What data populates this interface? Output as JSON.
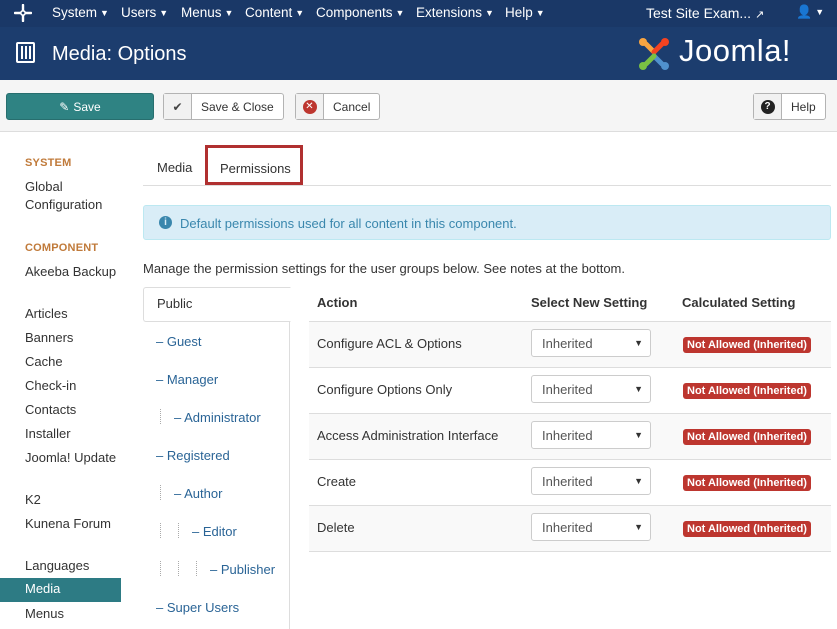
{
  "topnav": {
    "menus": [
      {
        "label": "System",
        "icon": "caret-down-icon"
      },
      {
        "label": "Users",
        "icon": "caret-down-icon"
      },
      {
        "label": "Menus",
        "icon": "caret-down-icon"
      },
      {
        "label": "Content",
        "icon": "caret-down-icon"
      },
      {
        "label": "Components",
        "icon": "caret-down-icon"
      },
      {
        "label": "Extensions",
        "icon": "caret-down-icon"
      },
      {
        "label": "Help",
        "icon": "caret-down-icon"
      }
    ],
    "site_label": "Test Site Exam...",
    "site_icon": "external-link-icon",
    "user_icon": "user-icon"
  },
  "header": {
    "title": "Media: Options",
    "brand": "Joomla!",
    "title_icon": "options-icon"
  },
  "toolbar": {
    "save_label": "Save",
    "save_close_label": "Save & Close",
    "cancel_label": "Cancel",
    "help_label": "Help"
  },
  "sidebar": {
    "system_heading": "SYSTEM",
    "system_items": [
      "Global Configuration"
    ],
    "component_heading": "COMPONENT",
    "component_items": [
      "Akeeba Backup",
      "Articles",
      "Banners",
      "Cache",
      "Check-in",
      "Contacts",
      "Installer",
      "Joomla! Update",
      "K2",
      "Kunena Forum",
      "Languages",
      "Media",
      "Menus"
    ],
    "active_item": "Media"
  },
  "tabs": {
    "media": "Media",
    "permissions": "Permissions",
    "active": "Permissions"
  },
  "info": {
    "message": "Default permissions used for all content in this component."
  },
  "manage_text": "Manage the permission settings for the user groups below. See notes at the bottom.",
  "groups": [
    "Public",
    "– Guest",
    "– Manager",
    "– Administrator",
    "– Registered",
    "– Author",
    "– Editor",
    "– Publisher",
    "– Super Users"
  ],
  "table": {
    "headers": [
      "Action",
      "Select New Setting",
      "Calculated Setting"
    ],
    "rows": [
      {
        "action": "Configure ACL & Options",
        "setting": "Inherited",
        "calculated": "Not Allowed (Inherited)"
      },
      {
        "action": "Configure Options Only",
        "setting": "Inherited",
        "calculated": "Not Allowed (Inherited)"
      },
      {
        "action": "Access Administration Interface",
        "setting": "Inherited",
        "calculated": "Not Allowed (Inherited)"
      },
      {
        "action": "Create",
        "setting": "Inherited",
        "calculated": "Not Allowed (Inherited)"
      },
      {
        "action": "Delete",
        "setting": "Inherited",
        "calculated": "Not Allowed (Inherited)"
      }
    ]
  },
  "colors": {
    "topnav_bg": "#1a3867",
    "header_bg": "#1c3d6e",
    "save_button": "#2f8383",
    "sidebar_active": "#2d7b84",
    "badge_danger": "#bd362f",
    "section_heading": "#c07a3a"
  }
}
